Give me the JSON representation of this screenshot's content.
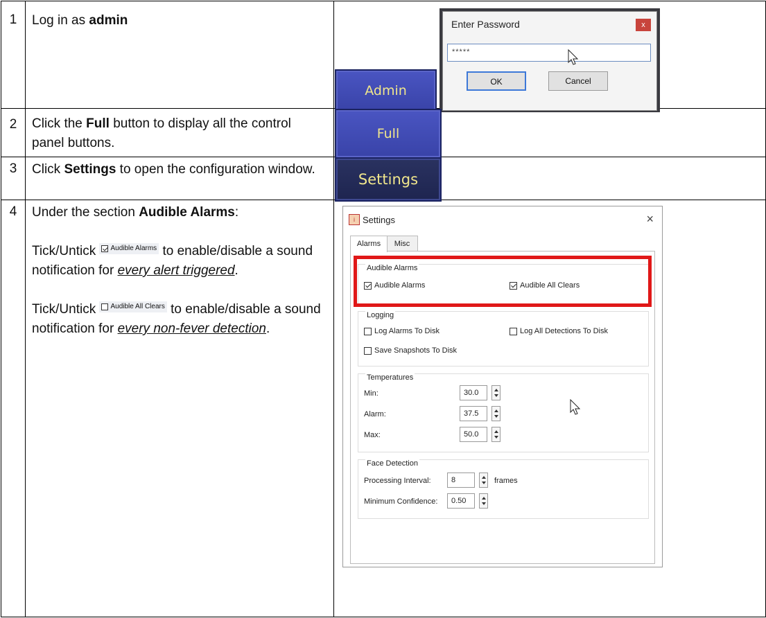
{
  "steps": [
    {
      "num": "1",
      "text_a": "Log in as ",
      "bold": "admin"
    },
    {
      "num": "2",
      "text_a": "Click the ",
      "bold": "Full",
      "text_b": " button to display all the control panel buttons."
    },
    {
      "num": "3",
      "text_a": "Click ",
      "bold": "Settings",
      "text_b": " to open the configuration window."
    },
    {
      "num": "4",
      "text_a": "Under the section ",
      "bold": "Audible Alarms",
      "text_b": ":"
    }
  ],
  "step4_detail": {
    "p1_a": "Tick/Untick ",
    "p1_chip": "Audible Alarms",
    "p1_b": " to enable/disable a sound notification for ",
    "p1_em": "every alert triggered",
    "p1_c": ".",
    "p2_a": "Tick/Untick ",
    "p2_chip": "Audible All Clears",
    "p2_b": " to enable/disable a sound notification for ",
    "p2_em": "every non-fever detection",
    "p2_c": "."
  },
  "buttons": {
    "admin": "Admin",
    "full": "Full",
    "settings": "Settings"
  },
  "password_dialog": {
    "title": "Enter Password",
    "close": "x",
    "masked_value": "*****",
    "ok": "OK",
    "cancel": "Cancel"
  },
  "settings_window": {
    "title": "Settings",
    "close": "×",
    "tabs": [
      "Alarms",
      "Misc"
    ],
    "audible_group": "Audible Alarms",
    "audible_alarms": "Audible Alarms",
    "audible_all_clears": "Audible All Clears",
    "logging_group": "Logging",
    "log_alarms": "Log Alarms To Disk",
    "log_detections": "Log All Detections To Disk",
    "save_snapshots": "Save Snapshots To Disk",
    "temps_group": "Temperatures",
    "min_label": "Min:",
    "min_value": "30.0",
    "alarm_label": "Alarm:",
    "alarm_value": "37.5",
    "max_label": "Max:",
    "max_value": "50.0",
    "face_group": "Face Detection",
    "interval_label": "Processing Interval:",
    "interval_value": "8",
    "interval_unit": "frames",
    "confidence_label": "Minimum Confidence:",
    "confidence_value": "0.50"
  },
  "colors": {
    "highlight": "#e01818",
    "button_text": "#f0e68c",
    "button_bg": "#3943a8"
  }
}
